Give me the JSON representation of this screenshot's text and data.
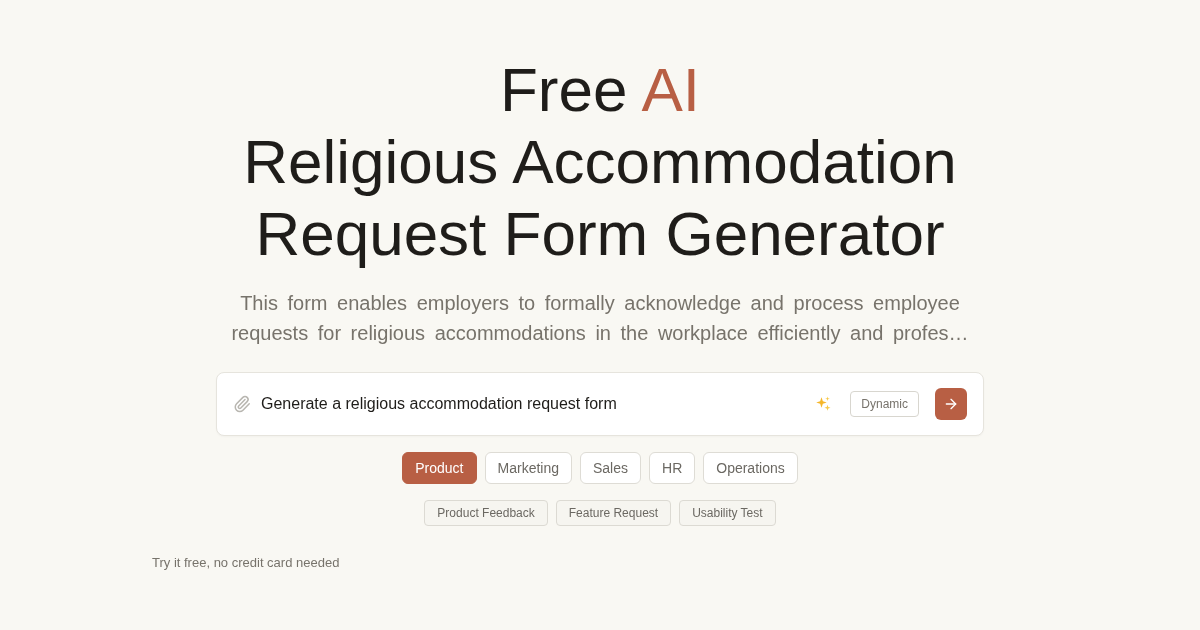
{
  "hero": {
    "title_prefix": "Free",
    "title_highlight": "AI",
    "title_lines": [
      "Religious Accommodation",
      "Request Form Generator"
    ],
    "description": "This form enables employers to formally acknowledge and process employee requests for religious accommodations in the workplace efficiently and profes…"
  },
  "prompt": {
    "value": "Generate a religious accommodation request form",
    "mode_badge": "Dynamic"
  },
  "categories": [
    {
      "label": "Product",
      "selected": true
    },
    {
      "label": "Marketing",
      "selected": false
    },
    {
      "label": "Sales",
      "selected": false
    },
    {
      "label": "HR",
      "selected": false
    },
    {
      "label": "Operations",
      "selected": false
    }
  ],
  "templates": [
    "Product Feedback",
    "Feature Request",
    "Usability Test"
  ],
  "footer_note": "Try it free, no credit card needed"
}
